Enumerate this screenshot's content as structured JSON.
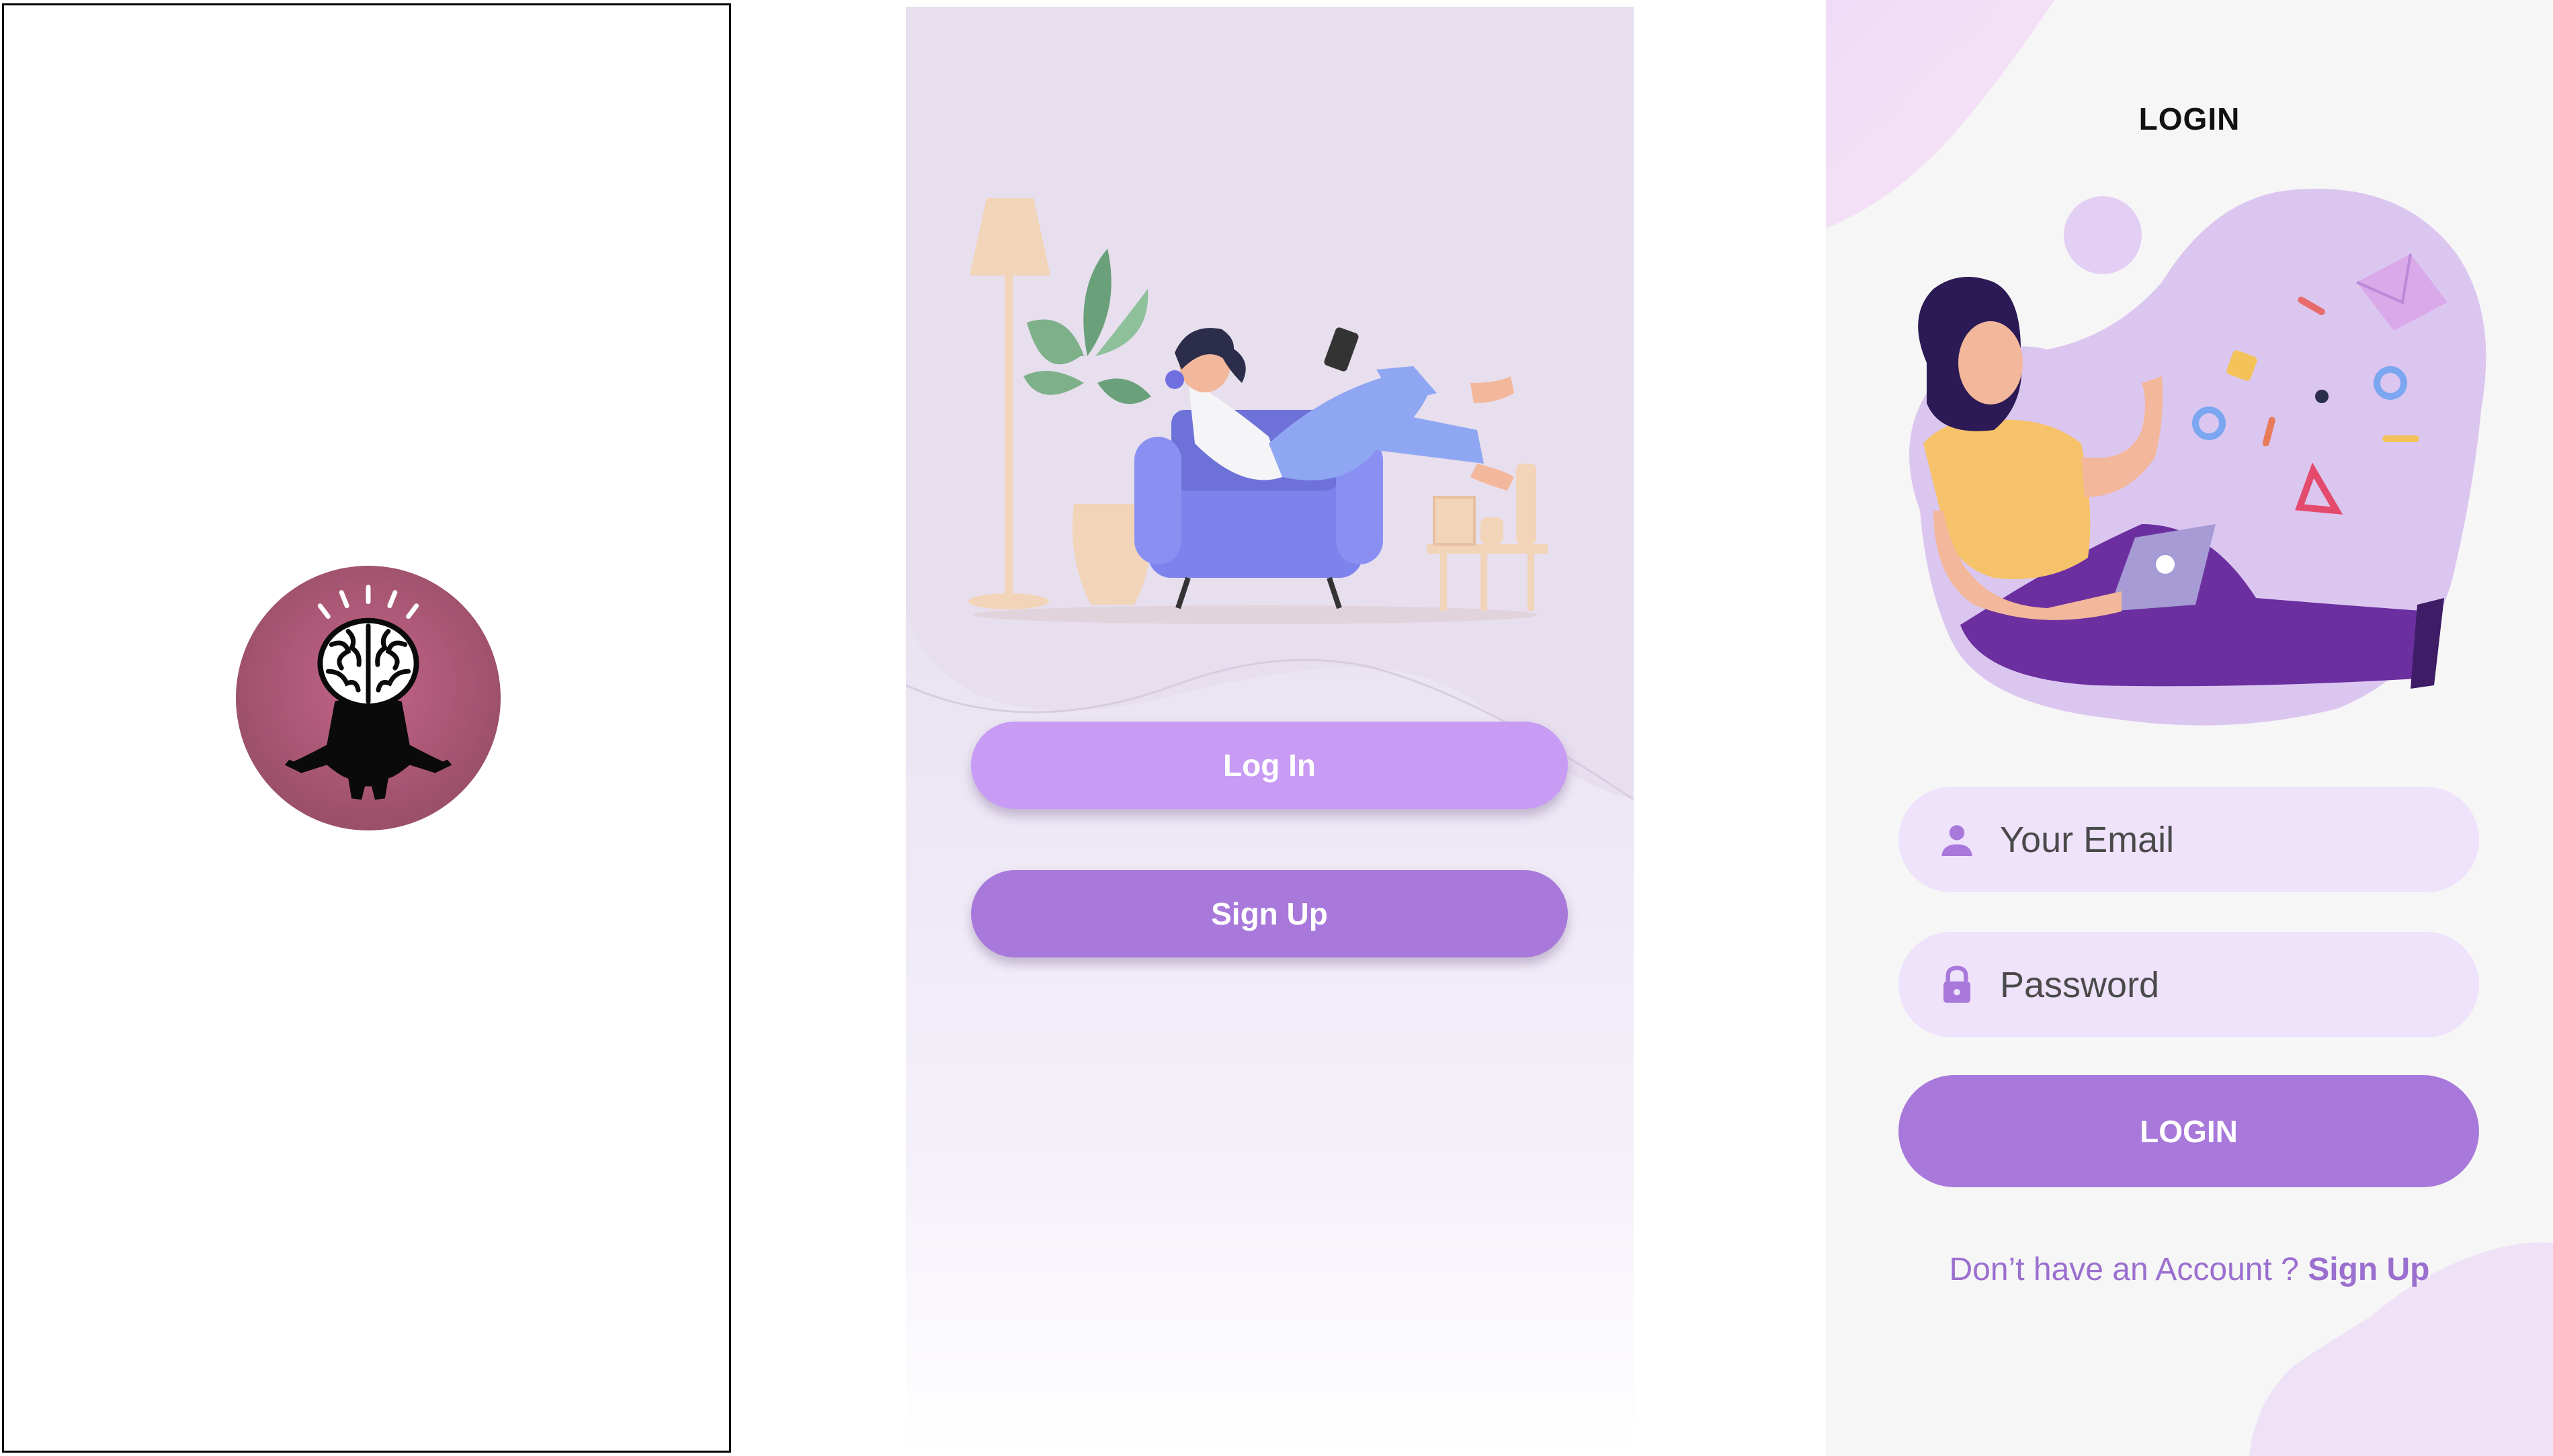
{
  "splash": {
    "logo_icon": "meditating-brain-icon",
    "logo_bg": "#b05a78"
  },
  "welcome": {
    "illustration_icon": "woman-reading-armchair-illustration",
    "login_label": "Log In",
    "signup_label": "Sign Up",
    "colors": {
      "login": "#c89bf5",
      "signup": "#a878da"
    }
  },
  "login": {
    "title": "LOGIN",
    "illustration_icon": "woman-with-laptop-illustration",
    "email": {
      "placeholder": "Your Email",
      "value": "",
      "icon": "person-icon"
    },
    "password": {
      "placeholder": "Password",
      "value": "",
      "icon": "lock-icon"
    },
    "submit_label": "LOGIN",
    "prompt_text": "Don’t have an Account ? ",
    "signup_link": "Sign Up",
    "colors": {
      "accent": "#a878da",
      "field_bg": "#efe2fb"
    }
  }
}
